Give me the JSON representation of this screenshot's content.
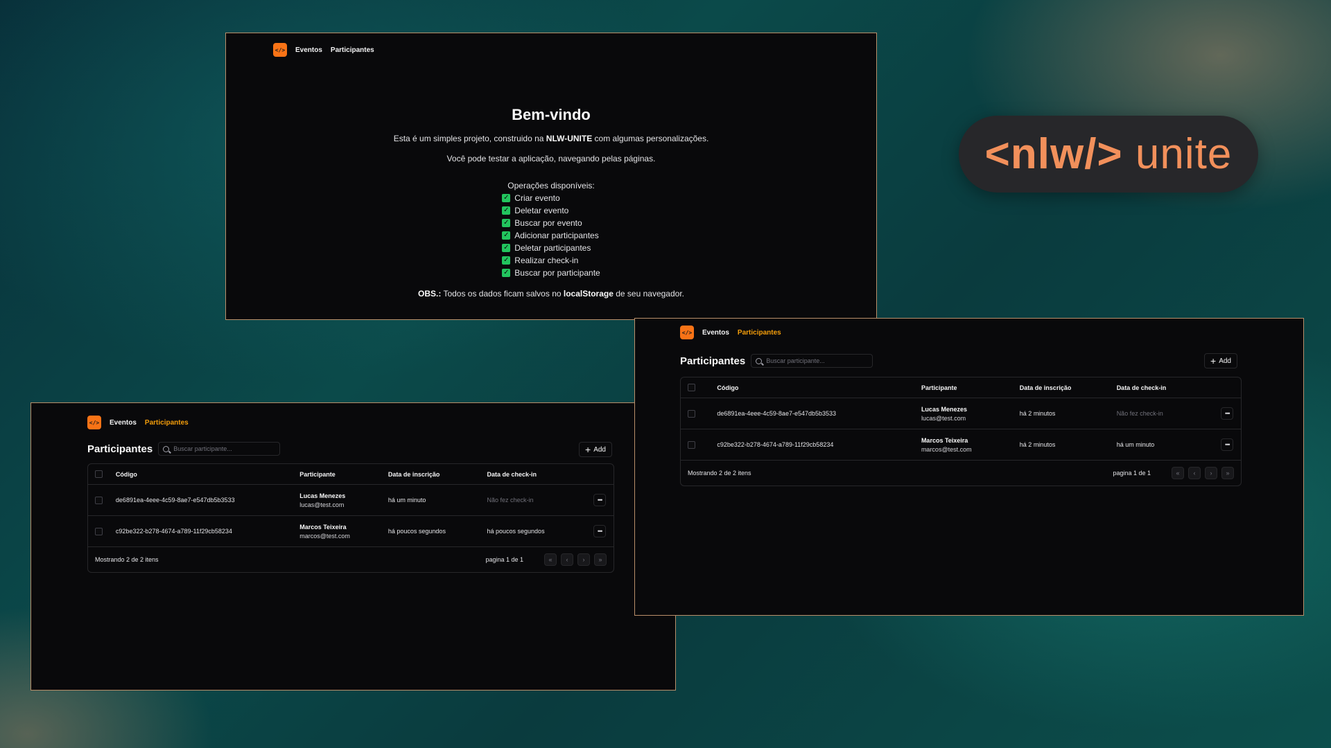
{
  "nav": {
    "logo_glyph": "</>",
    "events": "Eventos",
    "participants": "Participantes"
  },
  "welcome": {
    "title": "Bem-vindo",
    "line1_pre": "Esta é um simples projeto, construido na ",
    "line1_bold": "NLW-UNITE",
    "line1_post": " com algumas personalizações.",
    "line2": "Você pode testar a aplicação, navegando pelas páginas.",
    "ops_title": "Operações disponíveis:",
    "ops": [
      "Criar evento",
      "Deletar evento",
      "Buscar por evento",
      "Adicionar participantes",
      "Deletar participantes",
      "Realizar check-in",
      "Buscar por participante"
    ],
    "obs_label": "OBS.:",
    "obs_pre": " Todos os dados ficam salvos no ",
    "obs_bold": "localStorage",
    "obs_post": " de seu navegador."
  },
  "participants_page": {
    "title": "Participantes",
    "search_placeholder": "Buscar participante...",
    "add_label": "Add",
    "columns": [
      "Código",
      "Participante",
      "Data de inscrição",
      "Data de check-in"
    ],
    "footer_left": "Mostrando 2 de 2 itens",
    "page_info": "pagina 1 de 1",
    "pager_icons": [
      "«",
      "‹",
      "›",
      "»"
    ]
  },
  "left_rows": [
    {
      "code": "de6891ea-4eee-4c59-8ae7-e547db5b3533",
      "name": "Lucas Menezes",
      "email": "lucas@test.com",
      "signup": "há um minuto",
      "checkin": "Não fez check-in",
      "checkin_muted": true
    },
    {
      "code": "c92be322-b278-4674-a789-11f29cb58234",
      "name": "Marcos Teixeira",
      "email": "marcos@test.com",
      "signup": "há poucos segundos",
      "checkin": "há poucos segundos",
      "checkin_muted": false
    }
  ],
  "right_rows": [
    {
      "code": "de6891ea-4eee-4c59-8ae7-e547db5b3533",
      "name": "Lucas Menezes",
      "email": "lucas@test.com",
      "signup": "há 2 minutos",
      "checkin": "Não fez check-in",
      "checkin_muted": true
    },
    {
      "code": "c92be322-b278-4674-a789-11f29cb58234",
      "name": "Marcos Teixeira",
      "email": "marcos@test.com",
      "signup": "há 2 minutos",
      "checkin": "há um minuto",
      "checkin_muted": false
    }
  ],
  "brand": {
    "prefix": "<nlw/>",
    "suffix": " unite",
    "color": "#f2905b"
  },
  "colors": {
    "accent": "#f97316",
    "active_nav": "#f59e0b",
    "check": "#22c55e"
  }
}
